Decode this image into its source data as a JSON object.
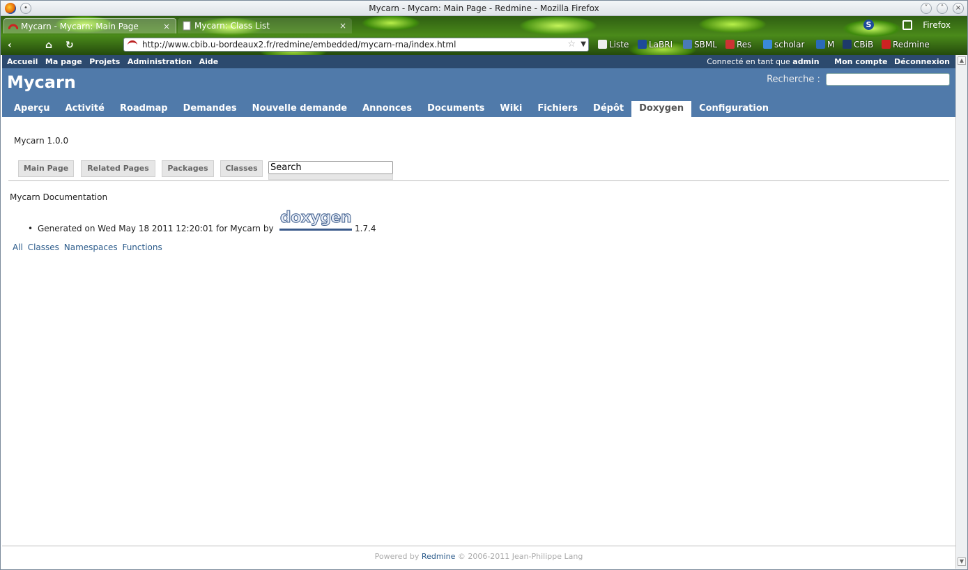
{
  "window": {
    "title": "Mycarn - Mycarn: Main Page - Redmine - Mozilla Firefox"
  },
  "tabs": [
    {
      "label": "Mycarn - Mycarn: Main Page",
      "close": "×"
    },
    {
      "label": "Mycarn: Class List",
      "close": "×"
    }
  ],
  "browser": {
    "firefox_label": "Firefox",
    "url": "http://www.cbib.u-bordeaux2.fr/redmine/embedded/mycarn-rna/index.html",
    "bookmarks": [
      "Liste",
      "LaBRI",
      "SBML",
      "Res",
      "scholar",
      "M",
      "CBiB",
      "Redmine"
    ]
  },
  "colors": {
    "header": "#507aaa",
    "top_menu": "#2c4a6e",
    "link": "#2a5a8a"
  },
  "top_menu": {
    "left": [
      "Accueil",
      "Ma page",
      "Projets",
      "Administration",
      "Aide"
    ],
    "logged_prefix": "Connecté en tant que",
    "logged_user": "admin",
    "my_account": "Mon compte",
    "logout": "Déconnexion"
  },
  "header": {
    "project": "Mycarn",
    "search_label": "Recherche :",
    "menu": [
      "Aperçu",
      "Activité",
      "Roadmap",
      "Demandes",
      "Nouvelle demande",
      "Annonces",
      "Documents",
      "Wiki",
      "Fichiers",
      "Dépôt",
      "Doxygen",
      "Configuration"
    ],
    "selected": "Doxygen"
  },
  "doxygen": {
    "project_number": "Mycarn 1.0.0",
    "tabs": [
      "Main Page",
      "Related Pages",
      "Packages",
      "Classes"
    ],
    "search_value": "Search",
    "title": "Mycarn Documentation",
    "generated": "Generated on Wed May 18 2011 12:20:01 for Mycarn by",
    "logo_text": "doxygen",
    "version": "1.7.4",
    "links": [
      "All",
      "Classes",
      "Namespaces",
      "Functions"
    ]
  },
  "footer": {
    "prefix": "Powered by",
    "link": "Redmine",
    "suffix": "© 2006-2011 Jean-Philippe Lang"
  }
}
